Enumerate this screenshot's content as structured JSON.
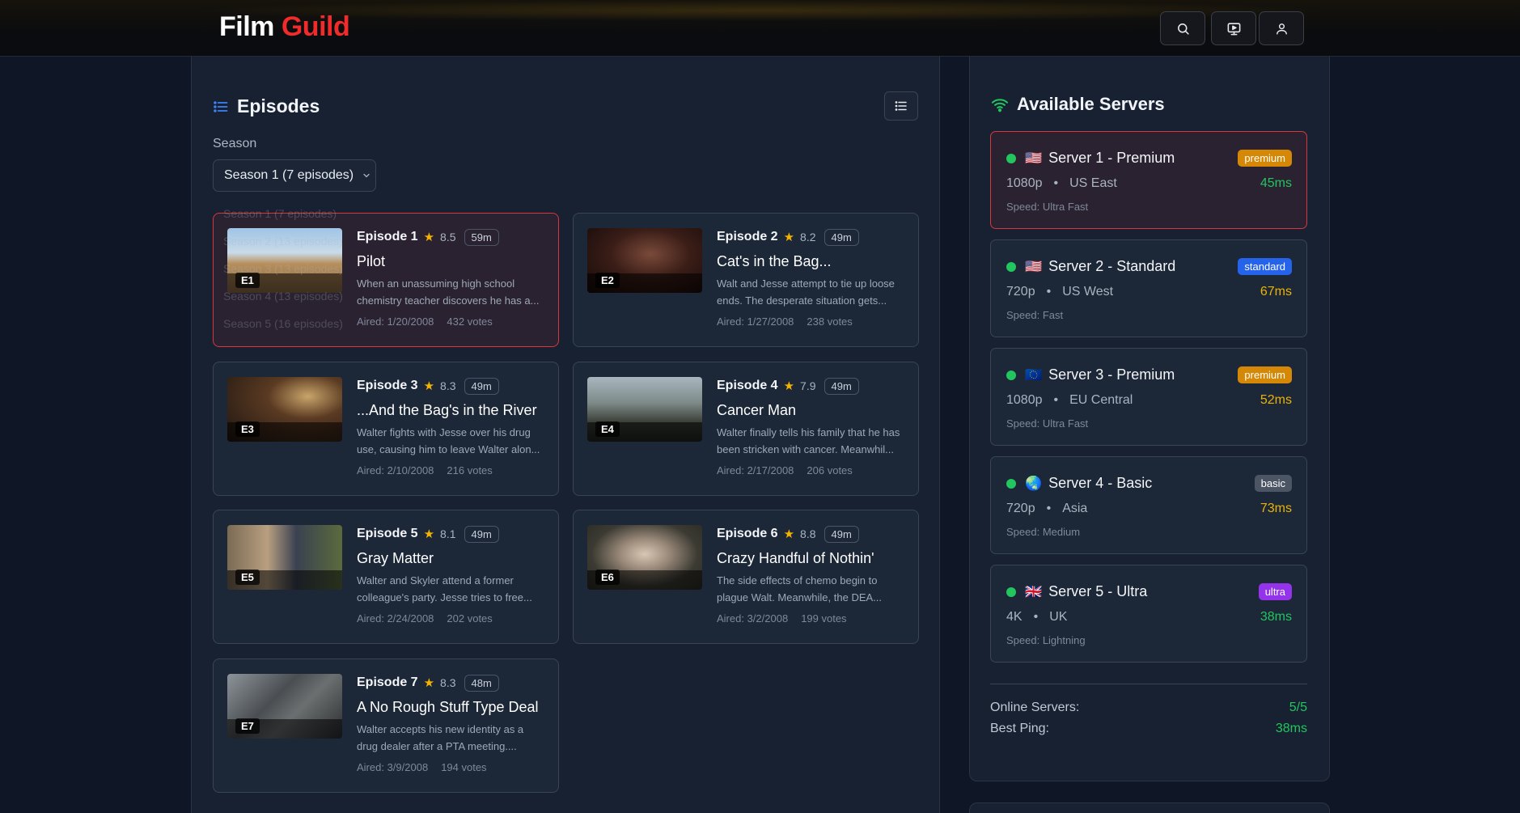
{
  "header": {
    "logo_part1": "Film",
    "logo_part2": "Guild",
    "icons": [
      "search-icon",
      "cast-icon",
      "user-icon"
    ]
  },
  "episodes_section": {
    "title": "Episodes",
    "season_label": "Season",
    "season_selected": "Season 1 (7 episodes)",
    "season_options_visible": [
      "Season 1 (7 episodes)",
      "Season 2 (13 episodes)",
      "Season 3 (13 episodes)",
      "Season 4 (13 episodes)",
      "Season 5 (16 episodes)"
    ],
    "episodes": [
      {
        "number": "Episode 1",
        "tag": "E1",
        "rating": "8.5",
        "duration": "59m",
        "title": "Pilot",
        "description": "When an unassuming high school chemistry teacher discovers he has a...",
        "aired": "Aired: 1/20/2008",
        "votes": "432 votes"
      },
      {
        "number": "Episode 2",
        "tag": "E2",
        "rating": "8.2",
        "duration": "49m",
        "title": "Cat's in the Bag...",
        "description": "Walt and Jesse attempt to tie up loose ends. The desperate situation gets...",
        "aired": "Aired: 1/27/2008",
        "votes": "238 votes"
      },
      {
        "number": "Episode 3",
        "tag": "E3",
        "rating": "8.3",
        "duration": "49m",
        "title": "...And the Bag's in the River",
        "description": "Walter fights with Jesse over his drug use, causing him to leave Walter alon...",
        "aired": "Aired: 2/10/2008",
        "votes": "216 votes"
      },
      {
        "number": "Episode 4",
        "tag": "E4",
        "rating": "7.9",
        "duration": "49m",
        "title": "Cancer Man",
        "description": "Walter finally tells his family that he has been stricken with cancer. Meanwhil...",
        "aired": "Aired: 2/17/2008",
        "votes": "206 votes"
      },
      {
        "number": "Episode 5",
        "tag": "E5",
        "rating": "8.1",
        "duration": "49m",
        "title": "Gray Matter",
        "description": "Walter and Skyler attend a former colleague's party. Jesse tries to free...",
        "aired": "Aired: 2/24/2008",
        "votes": "202 votes"
      },
      {
        "number": "Episode 6",
        "tag": "E6",
        "rating": "8.8",
        "duration": "49m",
        "title": "Crazy Handful of Nothin'",
        "description": "The side effects of chemo begin to plague Walt. Meanwhile, the DEA...",
        "aired": "Aired: 3/2/2008",
        "votes": "199 votes"
      },
      {
        "number": "Episode 7",
        "tag": "E7",
        "rating": "8.3",
        "duration": "48m",
        "title": "A No Rough Stuff Type Deal",
        "description": "Walter accepts his new identity as a drug dealer after a PTA meeting....",
        "aired": "Aired: 3/9/2008",
        "votes": "194 votes"
      }
    ]
  },
  "servers_section": {
    "title": "Available Servers",
    "servers": [
      {
        "flag": "🇺🇸",
        "name": "Server 1 - Premium",
        "badge": "premium",
        "badge_color": "#d48806",
        "quality": "1080p",
        "region": "US East",
        "ping": "45ms",
        "ping_color": "#22c55e",
        "speed": "Speed: Ultra Fast",
        "status_color": "#22c55e"
      },
      {
        "flag": "🇺🇸",
        "name": "Server 2 - Standard",
        "badge": "standard",
        "badge_color": "#2563eb",
        "quality": "720p",
        "region": "US West",
        "ping": "67ms",
        "ping_color": "#eab308",
        "speed": "Speed: Fast",
        "status_color": "#22c55e"
      },
      {
        "flag": "🇪🇺",
        "name": "Server 3 - Premium",
        "badge": "premium",
        "badge_color": "#d48806",
        "quality": "1080p",
        "region": "EU Central",
        "ping": "52ms",
        "ping_color": "#eab308",
        "speed": "Speed: Ultra Fast",
        "status_color": "#22c55e"
      },
      {
        "flag": "🌏",
        "name": "Server 4 - Basic",
        "badge": "basic",
        "badge_color": "#4b5563",
        "quality": "720p",
        "region": "Asia",
        "ping": "73ms",
        "ping_color": "#eab308",
        "speed": "Speed: Medium",
        "status_color": "#22c55e"
      },
      {
        "flag": "🇬🇧",
        "name": "Server 5 - Ultra",
        "badge": "ultra",
        "badge_color": "#9333ea",
        "quality": "4K",
        "region": "UK",
        "ping": "38ms",
        "ping_color": "#22c55e",
        "speed": "Speed: Lightning",
        "status_color": "#22c55e"
      }
    ],
    "stats": {
      "online_label": "Online Servers:",
      "online_value": "5/5",
      "best_ping_label": "Best Ping:",
      "best_ping_value": "38ms"
    }
  },
  "colors": {
    "brand_red": "#ef2b2b",
    "active_border": "#d9363e",
    "star": "#f5b300",
    "online_green": "#22c55e"
  }
}
